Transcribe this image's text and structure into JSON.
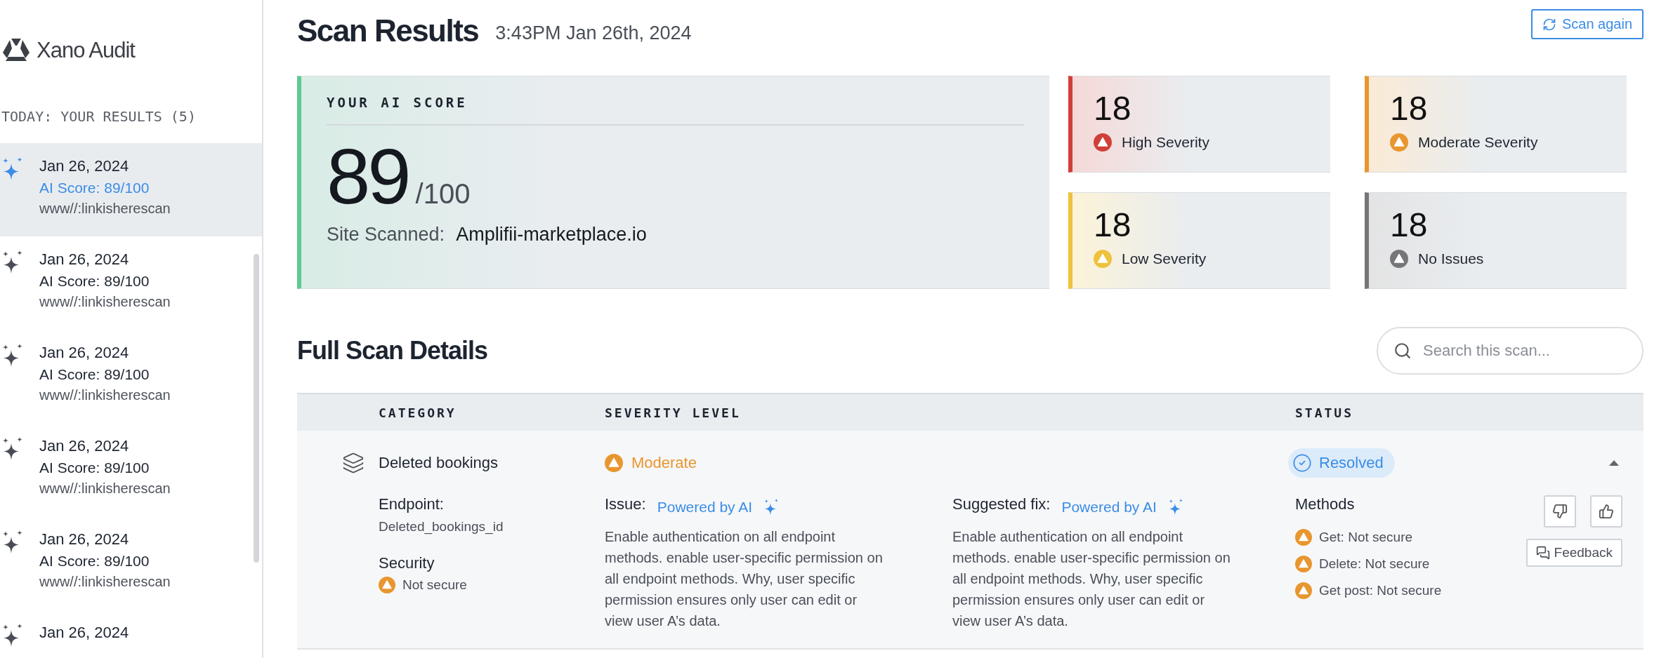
{
  "sidebar": {
    "logo": "Xano Audit",
    "section_title": "TODAY: YOUR RESULTS (5)",
    "items": [
      {
        "date": "Jan 26, 2024",
        "score": "AI Score: 89/100",
        "url": "www//:linkisherescan",
        "selected": true
      },
      {
        "date": "Jan 26, 2024",
        "score": "AI Score: 89/100",
        "url": "www//:linkisherescan",
        "selected": false
      },
      {
        "date": "Jan 26, 2024",
        "score": "AI Score: 89/100",
        "url": "www//:linkisherescan",
        "selected": false
      },
      {
        "date": "Jan 26, 2024",
        "score": "AI Score: 89/100",
        "url": "www//:linkisherescan",
        "selected": false
      },
      {
        "date": "Jan 26, 2024",
        "score": "AI Score: 89/100",
        "url": "www//:linkisherescan",
        "selected": false
      },
      {
        "date": "Jan 26, 2024",
        "selected": false
      }
    ]
  },
  "header": {
    "title": "Scan Results",
    "timestamp": "3:43PM Jan 26th, 2024",
    "scan_button": "Scan again"
  },
  "score_card": {
    "label": "YOUR AI SCORE",
    "score": "89",
    "out_of": "/100",
    "site_label": "Site Scanned:",
    "site": "Amplifii-marketplace.io"
  },
  "severity_cards": [
    {
      "count": "18",
      "label": "High Severity",
      "color": "#d0403a"
    },
    {
      "count": "18",
      "label": "Moderate Severity",
      "color": "#e8962f"
    },
    {
      "count": "18",
      "label": "Low Severity",
      "color": "#eec23c"
    },
    {
      "count": "18",
      "label": "No Issues",
      "color": "#76767a"
    }
  ],
  "details": {
    "title": "Full Scan Details",
    "search": {
      "placeholder": "Search this scan..."
    },
    "columns": [
      "CATEGORY",
      "SEVERITY LEVEL",
      "STATUS"
    ],
    "rows": [
      {
        "category": "Deleted bookings",
        "severity": "Moderate",
        "color": "#e8962f",
        "status": "Resolved",
        "expanded": true,
        "endpoint_label": "Endpoint:",
        "endpoint": "Deleted_bookings_id",
        "security_label": "Security",
        "security": "Not secure",
        "issue_label": "Issue:",
        "issue_tag": "Powered by AI",
        "issue_text": "Enable authentication on all endpoint methods. enable user-specific permission on all endpoint methods. Why, user specific permission ensures only user can edit or view user A’s data.",
        "fix_label": "Suggested fix:",
        "fix_tag": "Powered by AI",
        "fix_text": "Enable authentication on all endpoint methods. enable user-specific permission on all endpoint methods. Why, user specific permission ensures only user can edit or view user A’s data.",
        "methods_label": "Methods",
        "methods": [
          "Get: Not secure",
          "Delete: Not secure",
          "Get post: Not secure"
        ],
        "feedback": "Feedback"
      }
    ]
  }
}
